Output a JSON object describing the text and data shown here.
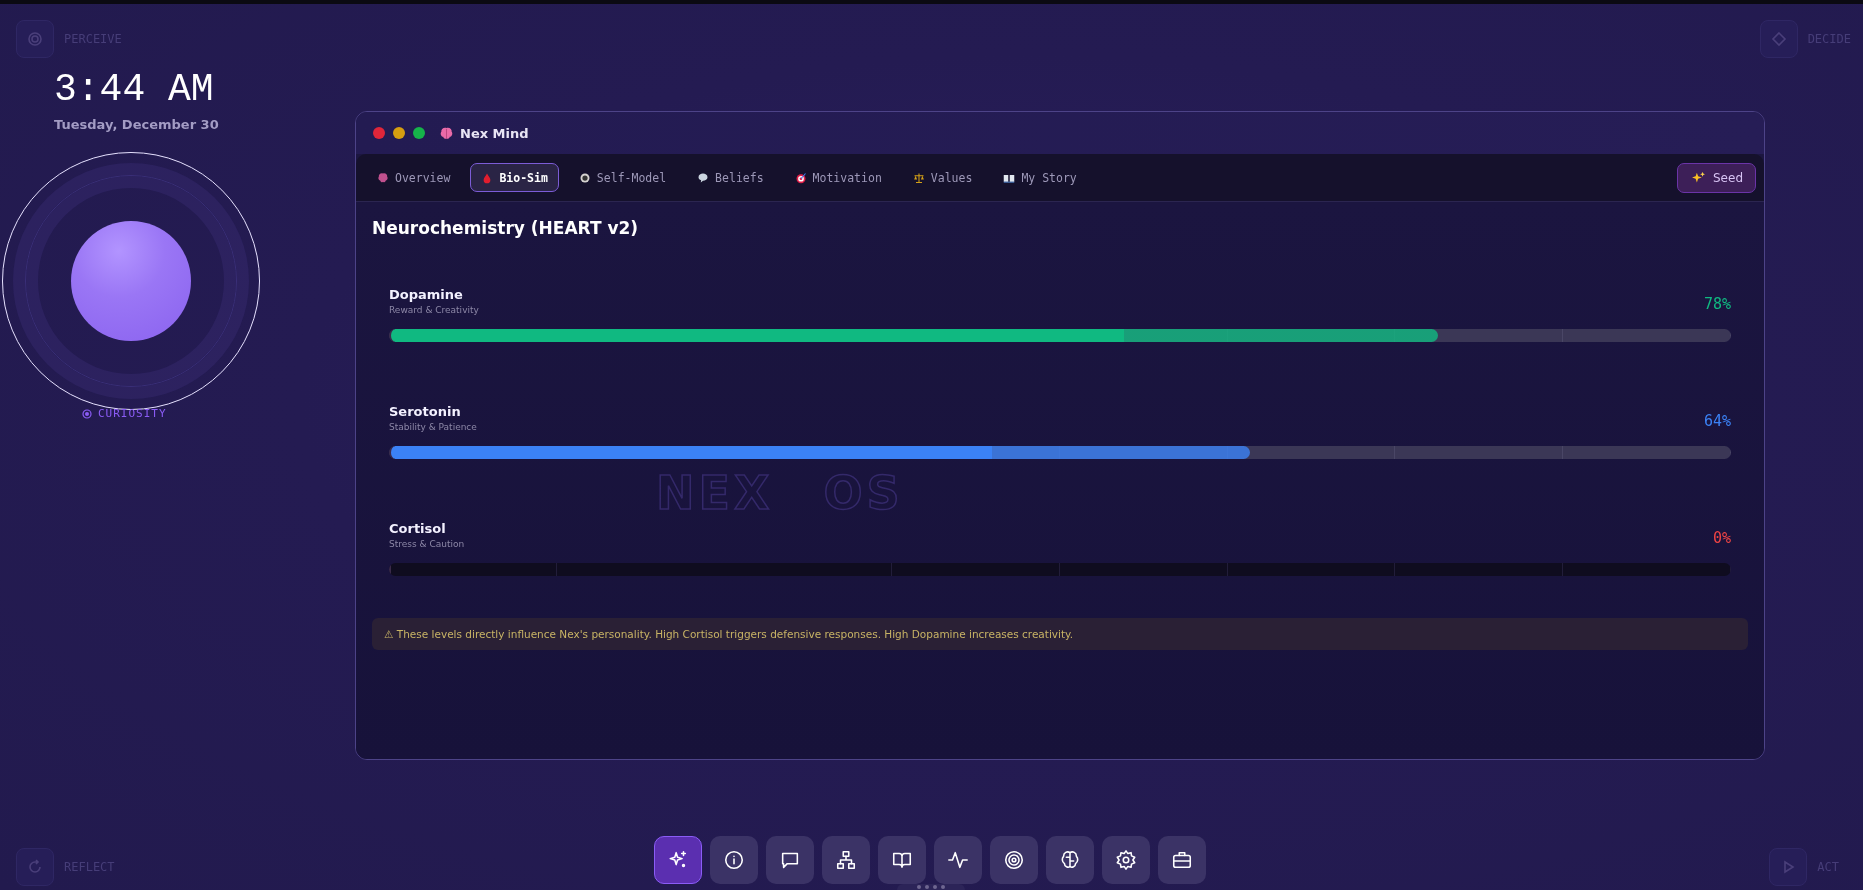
{
  "corners": {
    "top_left": "PERCEIVE",
    "top_right": "DECIDE",
    "bottom_left": "REFLECT",
    "bottom_right": "ACT"
  },
  "clock": {
    "time": "3:44 AM",
    "date": "Tuesday, December 30"
  },
  "mood": {
    "label": "CURIOSITY"
  },
  "backdrop": {
    "logo": "NEX OS"
  },
  "window": {
    "title": "Nex Mind",
    "tabs": [
      {
        "label": "Overview",
        "selected": false
      },
      {
        "label": "Bio-Sim",
        "selected": true
      },
      {
        "label": "Self-Model",
        "selected": false
      },
      {
        "label": "Beliefs",
        "selected": false
      },
      {
        "label": "Motivation",
        "selected": false
      },
      {
        "label": "Values",
        "selected": false
      },
      {
        "label": "My Story",
        "selected": false
      }
    ],
    "seed_button": "Seed",
    "heading": "Neurochemistry (HEART v2)",
    "chemicals": [
      {
        "name": "Dopamine",
        "description": "Reward & Creativity",
        "reading": "78%",
        "level": 0.78,
        "color": "#10b981"
      },
      {
        "name": "Serotonin",
        "description": "Stability & Patience",
        "reading": "64%",
        "level": 0.64,
        "color": "#3b82f6"
      },
      {
        "name": "Cortisol",
        "description": "Stress & Caution",
        "reading": "0%",
        "level": 0,
        "color": "#ef4444"
      }
    ],
    "notice": "⚠ These levels directly influence Nex's personality. High Cortisol triggers defensive responses. High Dopamine increases creativity."
  },
  "dock": [
    {
      "selected": true
    },
    {
      "selected": false
    },
    {
      "selected": false
    },
    {
      "selected": false
    },
    {
      "selected": false
    },
    {
      "selected": false
    },
    {
      "selected": false
    },
    {
      "selected": false
    },
    {
      "selected": false
    },
    {
      "selected": false
    }
  ]
}
